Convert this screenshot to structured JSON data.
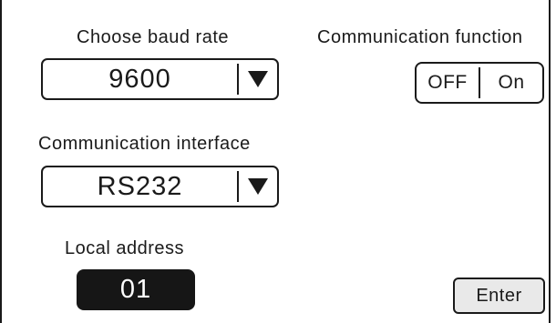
{
  "baud_rate": {
    "label": "Choose baud rate",
    "value": "9600",
    "dropdown_icon": "triangle-down-icon"
  },
  "communication_function": {
    "label": "Communication function",
    "off_label": "OFF",
    "on_label": "On"
  },
  "communication_interface": {
    "label": "Communication interface",
    "value": "RS232",
    "dropdown_icon": "triangle-down-icon"
  },
  "local_address": {
    "label": "Local address",
    "value": "01"
  },
  "enter_button": {
    "label": "Enter"
  },
  "colors": {
    "foreground": "#1a1a1a",
    "address_field_bg": "#161616",
    "button_bg": "#e9e9e9"
  }
}
